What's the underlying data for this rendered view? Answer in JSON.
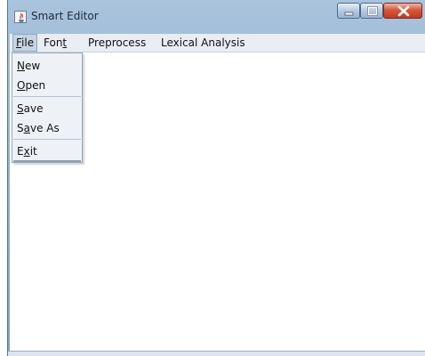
{
  "window": {
    "title": "Smart Editor",
    "icon": "java-cup-icon",
    "controls": {
      "minimize": "minimize-icon",
      "maximize": "maximize-icon",
      "close": "close-icon"
    }
  },
  "menubar": {
    "items": [
      {
        "pre": "",
        "ul": "F",
        "post": "ile"
      },
      {
        "pre": "Fon",
        "ul": "t",
        "post": ""
      },
      {
        "label": "Preprocess"
      },
      {
        "label": "Lexical Analysis"
      }
    ]
  },
  "file_menu": {
    "items": [
      {
        "pre": "",
        "ul": "N",
        "post": "ew"
      },
      {
        "pre": "",
        "ul": "O",
        "post": "pen"
      },
      {
        "pre": "",
        "ul": "S",
        "post": "ave"
      },
      {
        "pre": "S",
        "ul": "a",
        "post": "ve As"
      },
      {
        "pre": "E",
        "ul": "x",
        "post": "it"
      }
    ]
  },
  "colors": {
    "titlebar": "#a9c3dc",
    "menubar": "#e9eef4",
    "menu_selected": "#c6d4e5",
    "close_button": "#d9573a"
  }
}
